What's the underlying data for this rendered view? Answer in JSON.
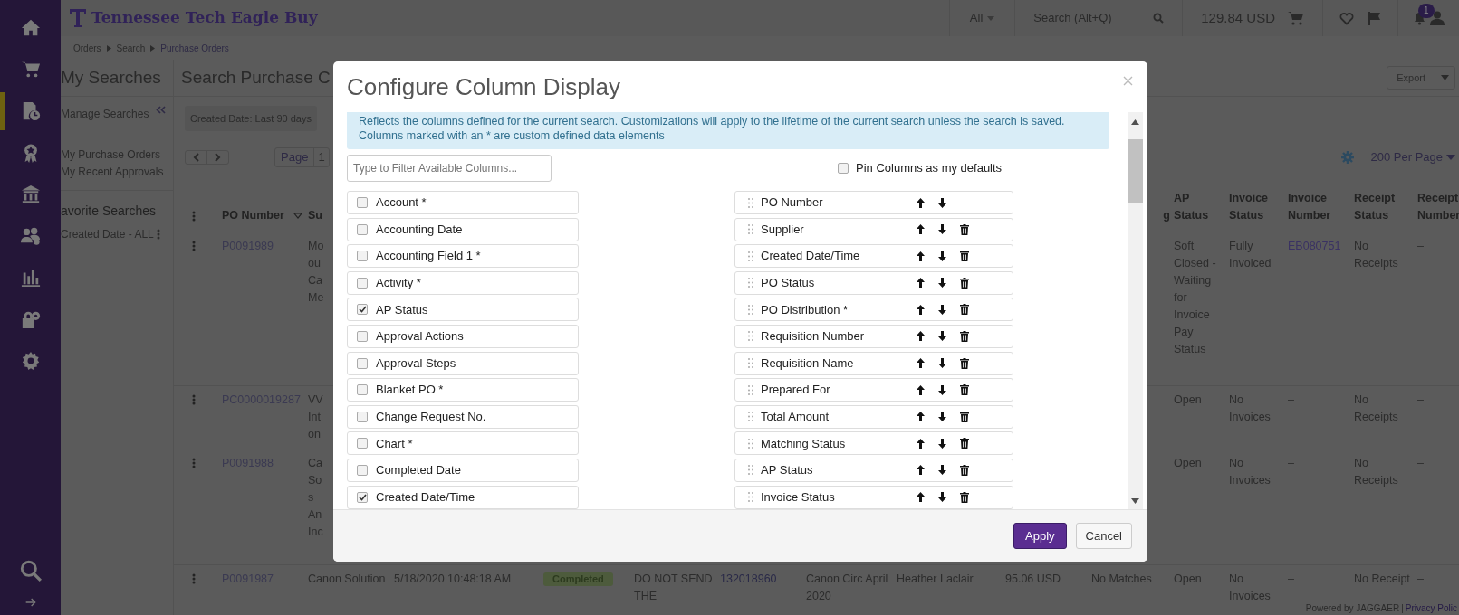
{
  "sidebar": {
    "items": [
      {
        "kind": "home",
        "selected": false
      },
      {
        "kind": "cart",
        "selected": false
      },
      {
        "kind": "document-clock",
        "selected": true
      },
      {
        "kind": "award",
        "selected": false
      },
      {
        "kind": "bank",
        "selected": false
      },
      {
        "kind": "users",
        "selected": false
      },
      {
        "kind": "chart",
        "selected": false
      },
      {
        "kind": "lock-gear",
        "selected": false
      },
      {
        "kind": "gear",
        "selected": false
      }
    ],
    "bottom": [
      {
        "kind": "search"
      },
      {
        "kind": "arrow"
      }
    ]
  },
  "top_bar": {
    "logo": "Tennessee Tech Eagle Buy",
    "search_scope": "All",
    "search_placeholder": "Search (Alt+Q)",
    "cart_total": "129.84 USD",
    "notification_count": "1"
  },
  "breadcrumb": [
    "Orders",
    "Search",
    "Purchase Orders"
  ],
  "left_panel": {
    "title": "My Searches",
    "manage": "Manage Searches",
    "links": [
      "My Purchase Orders",
      "My Recent Approvals"
    ],
    "favorites_title": "avorite Searches",
    "favorites": [
      "Created Date - ALL"
    ]
  },
  "main": {
    "title": "Search Purchase C",
    "export": "Export",
    "filter_chip": "Created Date: Last 90 days",
    "page_label": "Page",
    "page": "1",
    "per_page": "200 Per Page"
  },
  "table": {
    "columns": {
      "po_number": "PO Number",
      "column_3": "Su",
      "column_11": "g",
      "ap_status": "AP Status",
      "invoice_status": "Invoice Status",
      "invoice_number": "Invoice Number",
      "receipt_status": "Receipt Status",
      "receipt_number": "Receipt Number"
    },
    "rows": [
      {
        "po_number": "P0091989",
        "column_3": "Mo ou Ca Me",
        "ap_status": "Soft Closed - Waiting for Invoice Pay Status",
        "invoice_status": "Fully Invoiced",
        "invoice_number": "EB080751",
        "receipt_status": "No Receipts",
        "receipt_number": "–"
      },
      {
        "po_number": "PC0000019287",
        "column_3": "VV Int on",
        "ap_status": "Open",
        "invoice_status": "No Invoices",
        "invoice_number": "–",
        "receipt_status": "No Receipts",
        "receipt_number": "–"
      },
      {
        "po_number": "P0091988",
        "column_3": "Ca So s An Inc",
        "ap_status": "Open",
        "invoice_status": "No Invoices",
        "invoice_number": "–",
        "receipt_status": "No Receipts",
        "receipt_number": "–"
      },
      {
        "po_number": "P0091987",
        "column_3": "Canon Solution",
        "column_4": "5/18/2020 10:48:18 AM",
        "column_5": "Completed",
        "column_6": "DO NOT SEND THE",
        "column_7": "132018960",
        "column_8": "Canon Circ April 2020",
        "column_9": "Heather Laclair",
        "column_10": "95.06 USD",
        "column_11": "No Matches",
        "ap_status": "Open",
        "invoice_status": "No Invoices",
        "invoice_number": "–",
        "receipt_status": "No Receipt",
        "receipt_number": "–"
      }
    ]
  },
  "footer": {
    "powered": "Powered by JAGGAER",
    "separator": "|",
    "privacy": "Privacy Polic"
  },
  "modal": {
    "title": "Configure Column Display",
    "info": "Reflects the columns defined for the current search. Customizations will apply to the lifetime of the current search unless the search is saved. Columns marked with an * are custom defined data elements",
    "filter_placeholder": "Type to Filter Available Columns...",
    "pin": {
      "label": "Pin Columns as my defaults",
      "checked": false
    },
    "available": [
      {
        "label": "Account *",
        "checked": false
      },
      {
        "label": "Accounting Date",
        "checked": false
      },
      {
        "label": "Accounting Field 1 *",
        "checked": false
      },
      {
        "label": "Activity *",
        "checked": false
      },
      {
        "label": "AP Status",
        "checked": true
      },
      {
        "label": "Approval Actions",
        "checked": false
      },
      {
        "label": "Approval Steps",
        "checked": false
      },
      {
        "label": "Blanket PO *",
        "checked": false
      },
      {
        "label": "Change Request No.",
        "checked": false
      },
      {
        "label": "Chart *",
        "checked": false
      },
      {
        "label": "Completed Date",
        "checked": false
      },
      {
        "label": "Created Date/Time",
        "checked": true
      }
    ],
    "selected_columns": [
      {
        "label": "PO Number",
        "removable": false
      },
      {
        "label": "Supplier",
        "removable": true
      },
      {
        "label": "Created Date/Time",
        "removable": true
      },
      {
        "label": "PO Status",
        "removable": true
      },
      {
        "label": "PO Distribution *",
        "removable": true
      },
      {
        "label": "Requisition Number",
        "removable": true
      },
      {
        "label": "Requisition Name",
        "removable": true
      },
      {
        "label": "Prepared For",
        "removable": true
      },
      {
        "label": "Total Amount",
        "removable": true
      },
      {
        "label": "Matching Status",
        "removable": true
      },
      {
        "label": "AP Status",
        "removable": true
      },
      {
        "label": "Invoice Status",
        "removable": true
      }
    ],
    "apply": "Apply",
    "cancel": "Cancel"
  }
}
